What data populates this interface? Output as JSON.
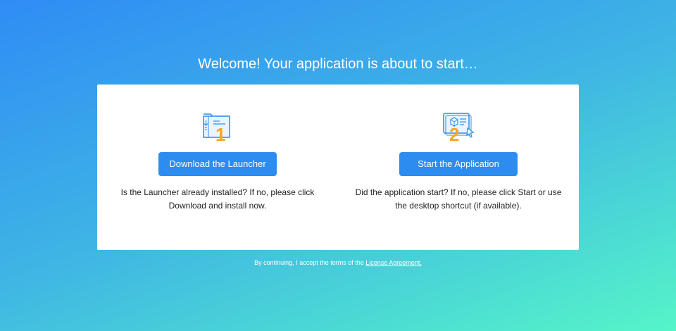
{
  "header": {
    "title": "Welcome! Your application is about to start…"
  },
  "steps": [
    {
      "number": "1",
      "button_label": "Download the Launcher",
      "description": "Is the Launcher already installed? If no, please click Download and install now.",
      "icon": "folder-download-icon"
    },
    {
      "number": "2",
      "button_label": "Start the Application",
      "description": "Did the application start? If no, please click Start or use the desktop shortcut (if available).",
      "icon": "app-window-cursor-icon"
    }
  ],
  "footer": {
    "text": "By continuing, I accept the terms of the",
    "link_label": "License Agreement."
  },
  "colors": {
    "accent": "#2d8cf0",
    "icon_stroke": "#2d8cf0",
    "step_number": "#f5a623",
    "gradient_start": "#2f8cf5",
    "gradient_end": "#55f5c8"
  }
}
